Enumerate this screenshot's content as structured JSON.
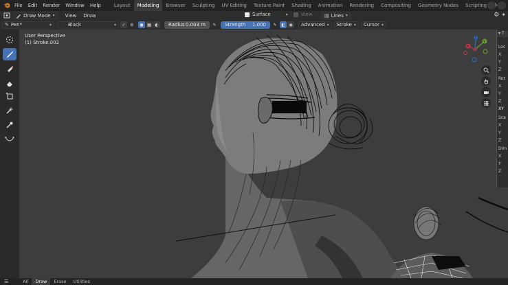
{
  "menu": {
    "file": "File",
    "edit": "Edit",
    "render": "Render",
    "window": "Window",
    "help": "Help"
  },
  "workspaces": [
    "Layout",
    "Modeling",
    "Browser",
    "Sculpting",
    "UV Editing",
    "Texture Paint",
    "Shading",
    "Animation",
    "Rendering",
    "Compositing",
    "Geometry Nodes",
    "Scripting"
  ],
  "active_workspace": "Modeling",
  "workspace_add": "+",
  "header": {
    "mode": "Draw Mode",
    "view": "View",
    "draw": "Draw",
    "surface": "Surface",
    "view2": "View",
    "lines": "Lines"
  },
  "tool_settings": {
    "brush": "Pen*",
    "material": "Black",
    "radius_label": "Radius",
    "radius_value": "0.003 m",
    "strength_label": "Strength",
    "strength_value": "1.000",
    "advanced": "Advanced",
    "stroke": "Stroke",
    "cursor": "Cursor"
  },
  "viewport": {
    "perspective": "User Perspective",
    "object": "(1) Stroke.002"
  },
  "gizmo": {
    "y": "Y",
    "x": "X",
    "z": "Z"
  },
  "npanel": {
    "rows": [
      "Loc",
      "X",
      "Y",
      "Z",
      "Rot",
      "X",
      "Y",
      "Z",
      "XY",
      "Sca",
      "X",
      "Y",
      "Z",
      "Dim",
      "X",
      "Y",
      "Z"
    ]
  },
  "statusbar": {
    "all": "All",
    "draw": "Draw",
    "erase": "Erase",
    "utilities": "Utilities"
  },
  "colors": {
    "accent": "#4772b3",
    "viewport": "#3d3d3d",
    "header": "#2d2d2d"
  }
}
